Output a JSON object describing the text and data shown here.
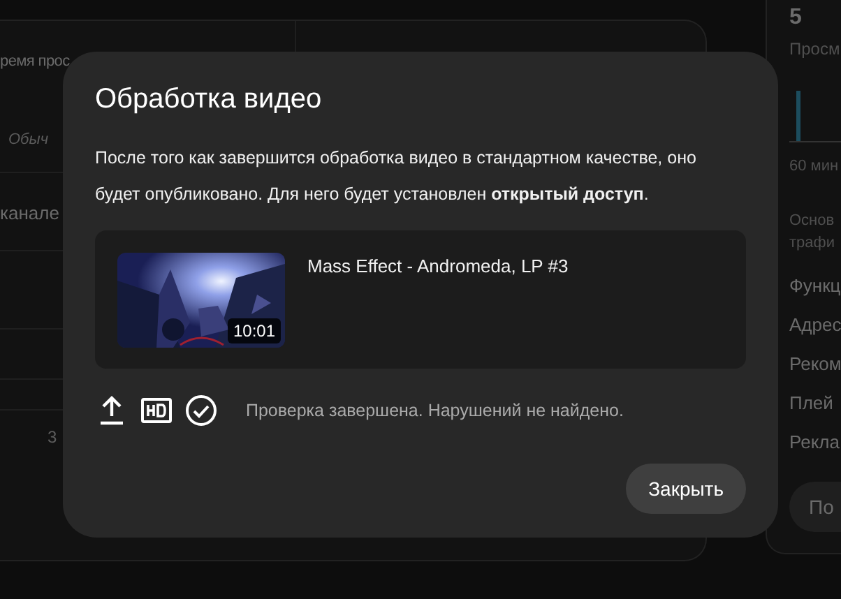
{
  "background": {
    "left_card": {
      "metric_label": "ремя прос",
      "metric_note": "Обыч",
      "row_label": "канале",
      "axis_label": "3"
    },
    "right_card": {
      "metric_value": "5",
      "metric_label": "Просм",
      "axis_label": "60 мин",
      "section_label": "Основ трафи",
      "sources": [
        "Функц",
        "Адрес",
        "Реком",
        "Плей",
        "Рекла"
      ],
      "button": "По"
    }
  },
  "dialog": {
    "title": "Обработка видео",
    "message": "После того как завершится обработка видео в стандартном качестве, оно будет опубликовано. Для него будет установлен **открытый доступ**.",
    "video": {
      "duration": "10:01",
      "title": "Mass Effect - Andromeda, LP #3"
    },
    "status_icons": [
      {
        "kind": "upload",
        "done": true
      },
      {
        "kind": "hd",
        "done": true
      },
      {
        "kind": "check",
        "done": true
      }
    ],
    "status_text": "Проверка завершена. Нарушений не найдено.",
    "buttons": [
      {
        "label": "Закрыть"
      }
    ]
  }
}
